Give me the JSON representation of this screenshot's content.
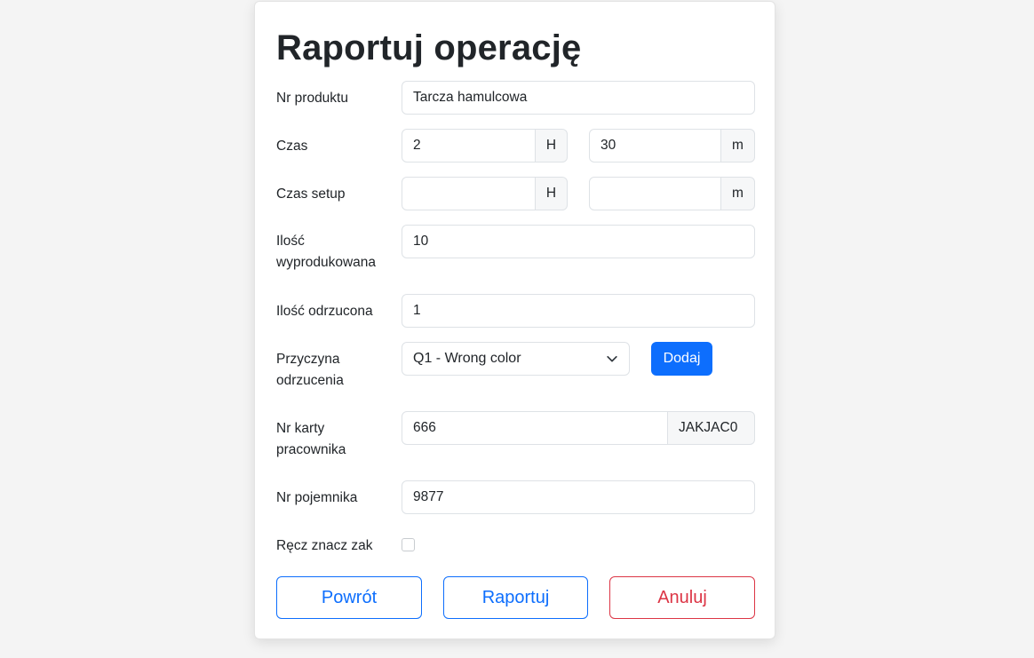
{
  "form": {
    "title": "Raportuj operację",
    "product": {
      "label": "Nr produktu",
      "value": "Tarcza hamulcowa"
    },
    "time": {
      "label": "Czas",
      "hours": "2",
      "hours_unit": "H",
      "minutes": "30",
      "minutes_unit": "m"
    },
    "setup_time": {
      "label": "Czas setup",
      "hours": "",
      "hours_unit": "H",
      "minutes": "",
      "minutes_unit": "m"
    },
    "produced_qty": {
      "label": "Ilość wyprodukowana",
      "value": "10"
    },
    "rejected_qty": {
      "label": "Ilość odrzucona",
      "value": "1"
    },
    "reject_reason": {
      "label": "Przyczyna odrzucenia",
      "selected": "Q1 - Wrong color",
      "add_label": "Dodaj"
    },
    "worker_card": {
      "label": "Nr karty pracownika",
      "value": "666",
      "worker_code": "JAKJAC0"
    },
    "container": {
      "label": "Nr pojemnika",
      "value": "9877"
    },
    "manual_mark": {
      "label": "Ręcz znacz zak",
      "checked": false
    }
  },
  "actions": {
    "back_label": "Powrót",
    "report_label": "Raportuj",
    "cancel_label": "Anuluj"
  },
  "colors": {
    "primary": "#0d6efd",
    "danger": "#dc3545",
    "page_background": "#f4f4f4"
  }
}
